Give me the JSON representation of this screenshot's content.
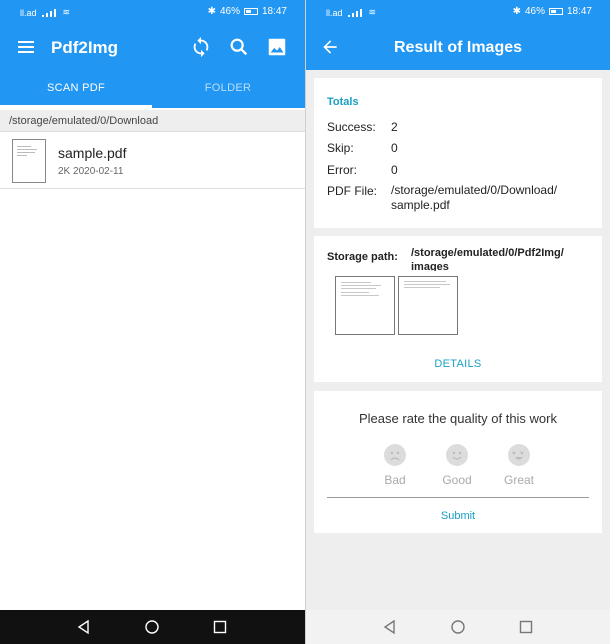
{
  "status_bar": {
    "left_text": "ll.ad",
    "battery": "46%",
    "time": "18:47"
  },
  "left_screen": {
    "app_title": "Pdf2Img",
    "tabs": [
      {
        "label": "SCAN PDF",
        "active": true
      },
      {
        "label": "FOLDER",
        "active": false
      }
    ],
    "current_path": "/storage/emulated/0/Download",
    "files": [
      {
        "name": "sample.pdf",
        "size": "2K",
        "date": "2020-02-11"
      }
    ],
    "icons": [
      "menu-icon",
      "sync-icon",
      "search-icon",
      "gallery-icon"
    ]
  },
  "right_screen": {
    "title": "Result of Images",
    "totals": {
      "heading": "Totals",
      "rows": [
        {
          "label": "Success:",
          "value": "2"
        },
        {
          "label": "Skip:",
          "value": "0"
        },
        {
          "label": "Error:",
          "value": "0"
        },
        {
          "label": "PDF File:",
          "value": "/storage/emulated/0/Download/ sample.pdf"
        }
      ]
    },
    "storage": {
      "label": "Storage path:",
      "value": "/storage/emulated/0/Pdf2Img/ images",
      "thumbnail_count": 2,
      "details_label": "DETAILS"
    },
    "rating": {
      "question": "Please rate the quality of this work",
      "options": [
        "Bad",
        "Good",
        "Great"
      ],
      "submit_label": "Submit"
    }
  },
  "colors": {
    "primary": "#2196f3",
    "accent": "#1aa0c4",
    "background": "#eeeeee"
  }
}
